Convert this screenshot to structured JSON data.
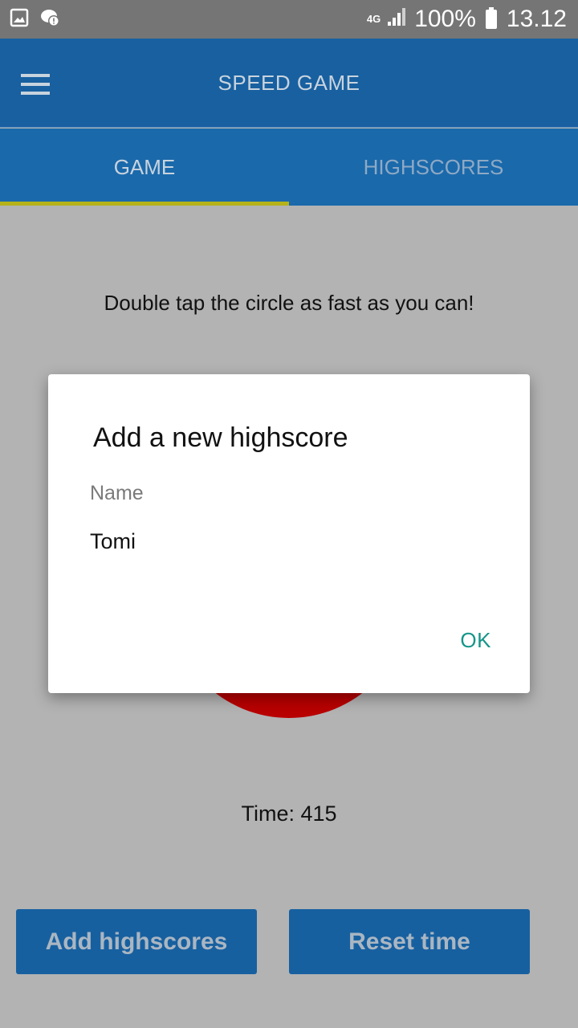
{
  "status_bar": {
    "network": "4G",
    "battery": "100%",
    "time": "13.12",
    "icons": [
      "gallery-icon",
      "notification-icon",
      "signal-icon",
      "battery-icon"
    ]
  },
  "app_bar": {
    "title": "SPEED GAME",
    "menu_icon": "hamburger-menu-icon"
  },
  "tabs": [
    {
      "label": "GAME",
      "active": true
    },
    {
      "label": "HIGHSCORES",
      "active": false
    }
  ],
  "game": {
    "instruction": "Double tap the circle as fast as you can!",
    "time_text": "Time: 415",
    "circle_color": "#b80000"
  },
  "buttons": {
    "add_label": "Add highscores",
    "reset_label": "Reset time"
  },
  "dialog": {
    "title": "Add a new highscore",
    "field_label": "Name",
    "field_value": "Tomi",
    "ok_label": "OK"
  },
  "colors": {
    "app_bar": "#1860a0",
    "tab_bar": "#1a69ab",
    "tab_indicator": "#b5b21a",
    "button": "#1760a0",
    "ok_text": "#159588"
  }
}
